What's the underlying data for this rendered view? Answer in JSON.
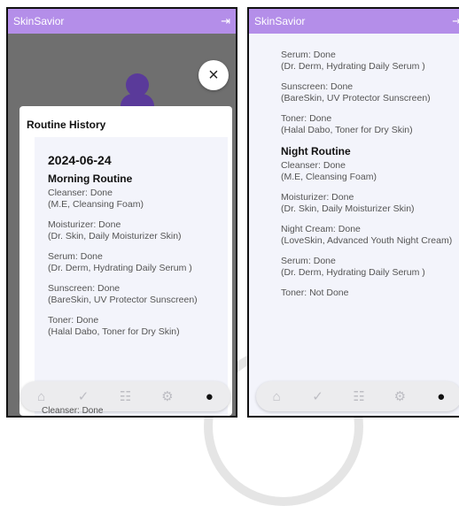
{
  "app": {
    "title": "SkinSavior"
  },
  "modal": {
    "title": "Routine History",
    "close_glyph": "×"
  },
  "left_card": {
    "date": "2024-06-24",
    "routine_title": "Morning Routine",
    "entries": [
      {
        "line1": "Cleanser: Done",
        "line2": "(M.E, Cleansing Foam)"
      },
      {
        "line1": "Moisturizer: Done",
        "line2": "(Dr. Skin, Daily Moisturizer Skin)"
      },
      {
        "line1": "Serum: Done",
        "line2": "(Dr. Derm, Hydrating Daily Serum )"
      },
      {
        "line1": "Sunscreen: Done",
        "line2": "(BareSkin, UV Protector Sunscreen)"
      },
      {
        "line1": "Toner: Done",
        "line2": "(Halal Dabo, Toner for Dry Skin)"
      }
    ],
    "peek_text": "Cleanser: Done"
  },
  "right_card": {
    "morning_entries": [
      {
        "line1": "Serum: Done",
        "line2": "(Dr. Derm, Hydrating Daily Serum )"
      },
      {
        "line1": "Sunscreen: Done",
        "line2": "(BareSkin, UV Protector Sunscreen)"
      },
      {
        "line1": "Toner: Done",
        "line2": "(Halal Dabo, Toner for Dry Skin)"
      }
    ],
    "night_title": "Night Routine",
    "night_entries": [
      {
        "line1": "Cleanser: Done",
        "line2": "(M.E, Cleansing Foam)"
      },
      {
        "line1": "Moisturizer: Done",
        "line2": "(Dr. Skin, Daily Moisturizer Skin)"
      },
      {
        "line1": "Night Cream: Done",
        "line2": "(LoveSkin, Advanced Youth Night Cream)"
      },
      {
        "line1": "Serum: Done",
        "line2": "(Dr. Derm, Hydrating Daily Serum )"
      },
      {
        "line1": "Toner: Not Done",
        "line2": ""
      }
    ]
  },
  "nav": {
    "items": [
      {
        "icon": "home-icon",
        "glyph": "⌂"
      },
      {
        "icon": "check-circle-icon",
        "glyph": "✓"
      },
      {
        "icon": "checklist-icon",
        "glyph": "☷"
      },
      {
        "icon": "robot-icon",
        "glyph": "⚙"
      },
      {
        "icon": "profile-icon",
        "glyph": "●"
      }
    ],
    "active_index": 4
  },
  "colors": {
    "appbar": "#b48ee9",
    "card": "#f3f4fb",
    "avatar": "#5a3a9a",
    "dim": "#6f6f6f"
  }
}
